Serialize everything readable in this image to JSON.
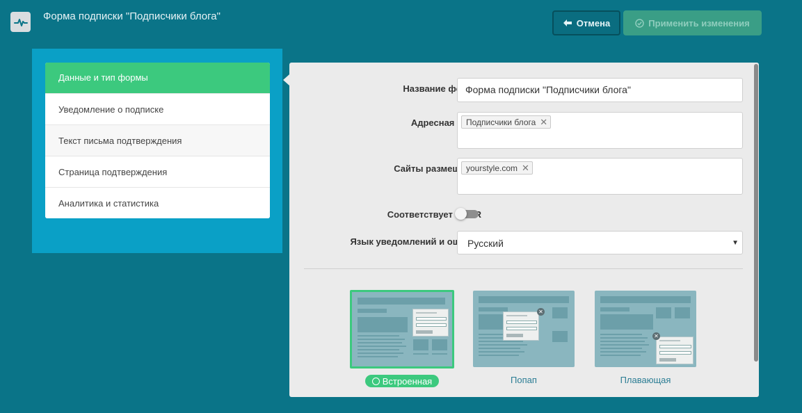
{
  "header": {
    "title": "Форма подписки \"Подписчики блога\"",
    "cancel_label": "Отмена",
    "apply_label": "Применить изменения"
  },
  "sidebar": {
    "items": [
      {
        "label": "Данные и тип формы",
        "active": true
      },
      {
        "label": "Уведомление о подписке"
      },
      {
        "label": "Текст письма подтверждения"
      },
      {
        "label": "Страница подтверждения"
      },
      {
        "label": "Аналитика и статистика"
      }
    ]
  },
  "form": {
    "name_label": "Название формы",
    "name_value": "Форма подписки \"Подписчики блога\"",
    "addressbook_label": "Адресная книга",
    "addressbook_tag": "Подписчики блога",
    "sites_label": "Сайты размещения",
    "sites_tag": "yourstyle.com",
    "gdpr_label": "Соответствует GDPR",
    "gdpr_on": false,
    "language_label": "Язык уведомлений и ошибок",
    "language_value": "Русский"
  },
  "form_types": [
    {
      "label": "Встроенная",
      "selected": true
    },
    {
      "label": "Попап",
      "selected": false
    },
    {
      "label": "Плавающая",
      "selected": false
    }
  ],
  "colors": {
    "background": "#0a7488",
    "accent": "#3cc97e",
    "panel": "#0aa0c6"
  },
  "icons": {
    "logo": "pulse-icon",
    "cancel": "arrow-left-icon",
    "apply": "check-circle-icon",
    "tag_remove": "close-icon",
    "select": "caret-down-icon"
  }
}
